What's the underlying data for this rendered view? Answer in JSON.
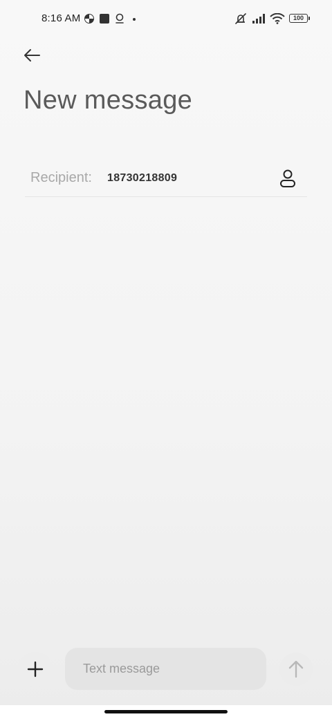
{
  "status_bar": {
    "time": "8:16 AM",
    "battery": "100",
    "icons": [
      "pinwheel-icon",
      "square-app-icon",
      "location-icon",
      "dot-icon",
      "mute-icon",
      "signal-icon",
      "wifi-icon",
      "battery-icon"
    ]
  },
  "header": {
    "back_icon": "back-arrow-icon",
    "title": "New message"
  },
  "recipient": {
    "label": "Recipient:",
    "value": "18730218809",
    "contact_icon": "contact-icon"
  },
  "composer": {
    "add_icon": "plus-icon",
    "input_placeholder": "Text message",
    "input_value": "",
    "send_icon": "send-arrow-icon"
  },
  "colors": {
    "title_text": "#5a5a5a",
    "label_text": "#a8a8a8",
    "input_bg": "#e4e4e4",
    "send_icon": "#b8b8b8"
  }
}
